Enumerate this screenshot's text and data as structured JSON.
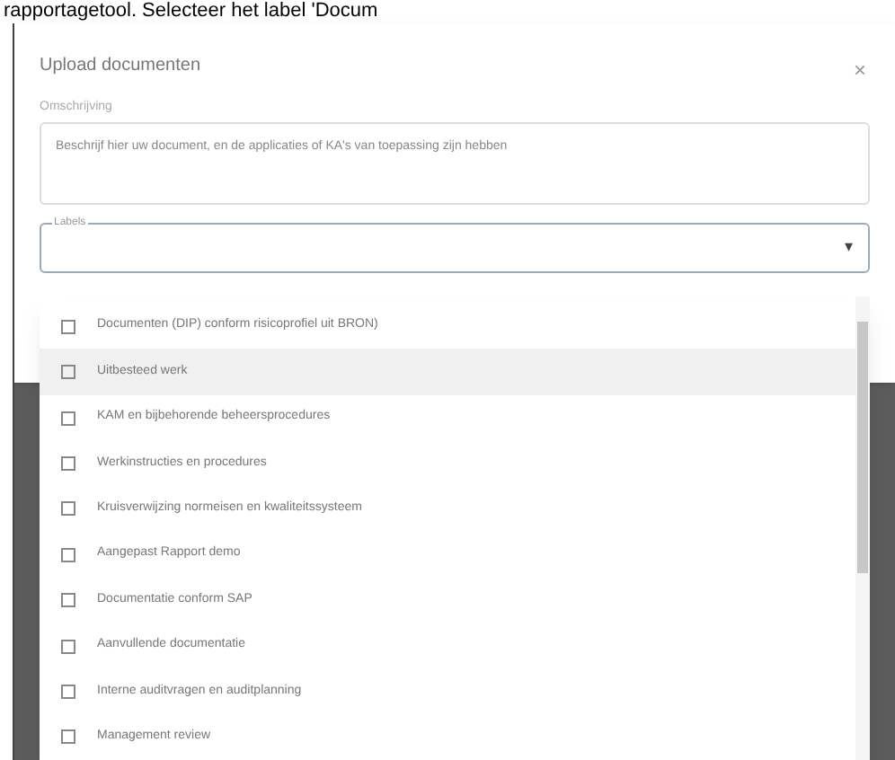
{
  "caption": "rapportagetool. Selecteer het label 'Docum",
  "dialog": {
    "title": "Upload documenten",
    "close": "×"
  },
  "description": {
    "label": "Omschrijving",
    "value": "Beschrijf hier uw document, en de applicaties of KA's van toepassing zijn hebben"
  },
  "labels": {
    "label": "Labels",
    "caret": "▾"
  },
  "options": [
    {
      "label": "Documenten (DIP) conform risicoprofiel uit BRON)",
      "checked": false,
      "hovered": false
    },
    {
      "label": "Uitbesteed werk",
      "checked": false,
      "hovered": true
    },
    {
      "label": "KAM en bijbehorende beheersprocedures",
      "checked": false,
      "hovered": false
    },
    {
      "label": "Werkinstructies en procedures",
      "checked": false,
      "hovered": false
    },
    {
      "label": "Kruisverwijzing normeisen en kwaliteitssysteem",
      "checked": false,
      "hovered": false
    },
    {
      "label": "Aangepast Rapport demo",
      "checked": false,
      "hovered": false
    },
    {
      "label": "Documentatie conform SAP",
      "checked": false,
      "hovered": false
    },
    {
      "label": "Aanvullende documentatie",
      "checked": false,
      "hovered": false
    },
    {
      "label": "Interne auditvragen en auditplanning",
      "checked": false,
      "hovered": false
    },
    {
      "label": "Management review",
      "checked": false,
      "hovered": false
    }
  ]
}
